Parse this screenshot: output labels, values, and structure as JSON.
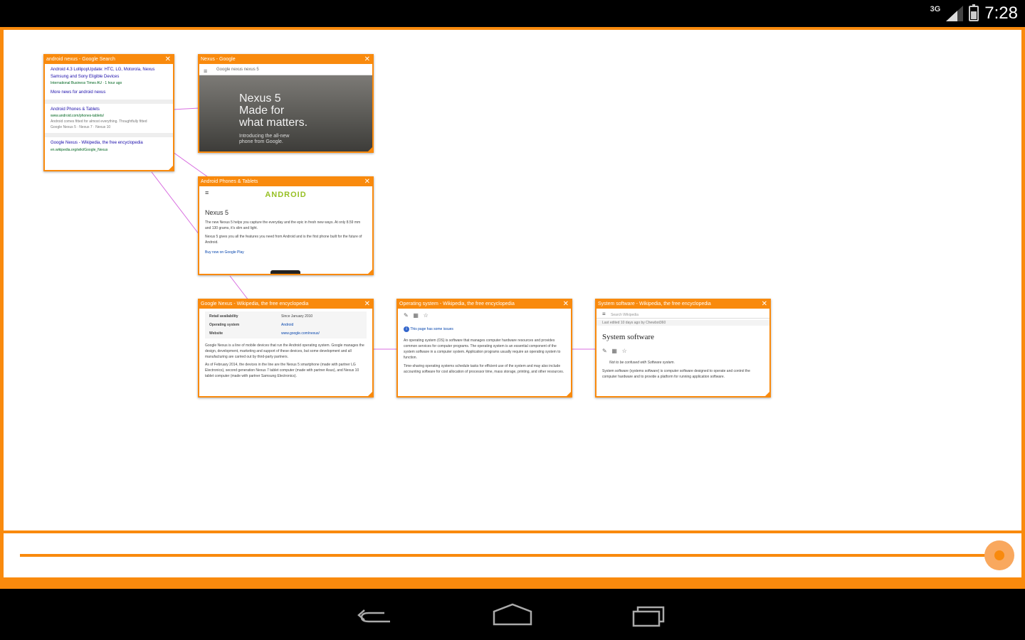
{
  "status_bar": {
    "network": "3G",
    "time": "7:28"
  },
  "tabs": [
    {
      "title": "android nexus - Google Search",
      "lines": [
        {
          "text": "Android 4.3 LollipopUpdate: HTC, LG, Motorola, Nexus",
          "style": "link"
        },
        {
          "text": "Samsung and Sony Eligible Devices",
          "style": "link"
        },
        {
          "text": "International Business Times AU · 1 hour ago",
          "style": "green"
        },
        {
          "text": "More news for android nexus",
          "style": "link"
        },
        {
          "text": "Android Phones & Tablets",
          "style": "link"
        },
        {
          "text": "www.android.com/phones-tablets/",
          "style": "green"
        },
        {
          "text": "Android comes fitted for almost everything. Thoughtfully fitted",
          "style": "grey"
        },
        {
          "text": "Google Nexus 5 · Nexus 7 · Nexus 10",
          "style": "grey"
        },
        {
          "text": "Google Nexus - Wikipedia, the free encyclopedia",
          "style": "link"
        },
        {
          "text": "en.wikipedia.org/wiki/Google_Nexus",
          "style": "green"
        }
      ]
    },
    {
      "title": "Nexus - Google",
      "toolbar": "Google     nexus     nexus 5",
      "hero_title": "Nexus 5\nMade for\nwhat matters.",
      "hero_sub": "Introducing the all-new\nphone from Google."
    },
    {
      "title": "Android Phones & Tablets",
      "logo": "ANDROID",
      "heading": "Nexus 5",
      "paragraphs": [
        "The new Nexus 5 helps you capture the everyday and the epic in fresh new ways. At only 8.59 mm and 130 grams, it's slim and light.",
        "Nexus 5 gives you all the features you need from Android and is the first phone built for the future of Android.",
        "Buy now on Google Play"
      ]
    },
    {
      "title": "Google Nexus - Wikipedia, the free encyclopedia",
      "table": [
        {
          "k": "Retail availability",
          "v": "Since January 2010"
        },
        {
          "k": "Operating system",
          "v": "Android"
        },
        {
          "k": "Website",
          "v": "www.google.com/nexus/"
        }
      ],
      "paragraphs": [
        "Google Nexus is a line of mobile devices that run the Android operating system. Google manages the design, development, marketing and support of these devices, but some development and all manufacturing are carried out by third-party partners.",
        "As of February 2014, the devices in the line are the Nexus 5 smartphone (made with partner LG Electronics), second generation Nexus 7 tablet computer (made with partner Asus), and Nexus 10 tablet computer (made with partner Samsung Electronics)."
      ]
    },
    {
      "title": "Operating system - Wikipedia, the free encyclopedia",
      "notice": "This page has some issues",
      "paragraphs": [
        "An operating system (OS) is software that manages computer hardware resources and provides common services for computer programs. The operating system is an essential component of the system software in a computer system. Application programs usually require an operating system to function.",
        "Time-sharing operating systems schedule tasks for efficient use of the system and may also include accounting software for cost allocation of processor time, mass storage, printing, and other resources."
      ]
    },
    {
      "title": "System software - Wikipedia, the free encyclopedia",
      "search_placeholder": "Search Wikipedia",
      "edited": "Last edited 10 days ago by Chewbot360",
      "heading": "System software",
      "note": "Not to be confused with Software system.",
      "paragraphs": [
        "System software (systems software) is computer software designed to operate and control the computer hardware and to provide a platform for running application software."
      ]
    }
  ],
  "timeline": {
    "position": 1.0
  },
  "nav": {
    "back": "back-icon",
    "home": "home-icon",
    "recents": "recents-icon"
  },
  "colors": {
    "accent": "#f98a0d",
    "link": "#1a0dab",
    "url": "#006621",
    "tree_line": "#d86ee0"
  }
}
